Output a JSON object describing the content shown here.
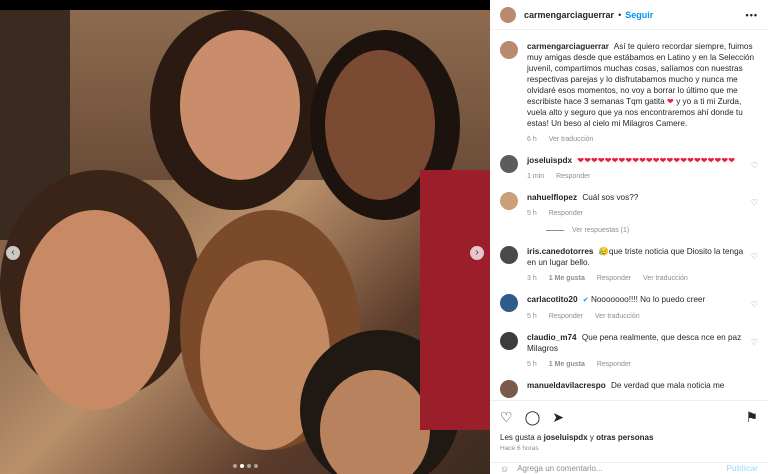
{
  "header": {
    "username": "carmengarciaguerrar",
    "separator": "•",
    "follow_label": "Seguir",
    "more_label": "•••"
  },
  "caption": {
    "username": "carmengarciaguerrar",
    "text_part1": "Así te quiero recordar siempre, fuimos muy amigas desde que estábamos en Latino y en la Selección juvenil, compartimos muchas cosas, salíamos con nuestras respectivas parejas y lo disfrutabamos mucho y nunca me olvidaré esos momentos, no voy a borrar lo último que me escribiste hace 3 semanas Tqm gatita",
    "heart": "❤",
    "text_part2": "y yo a ti mi Zurda, vuela alto y seguro que ya nos encontraremos ahí donde tu estas! Un beso al cielo mi Milagros Camere.",
    "time": "6 h",
    "translate": "Ver traducción"
  },
  "comments": [
    {
      "username": "joseluispdx",
      "text": "❤❤❤❤❤❤❤❤❤❤❤❤❤❤❤❤❤❤❤❤❤❤❤",
      "time": "1 min",
      "likes": "",
      "reply": "Responder",
      "translate": "",
      "avatar_color": "#5c5c5c",
      "is_hearts": true
    },
    {
      "username": "nahuelflopez",
      "text": "Cuál sos vos??",
      "time": "5 h",
      "likes": "",
      "reply": "Responder",
      "translate": "",
      "avatar_color": "#c9a07a",
      "is_hearts": false
    },
    {
      "username": "iris.canedotorres",
      "text": "😥que triste noticia que Diosito la tenga en un lugar bello.",
      "time": "3 h",
      "likes": "1 Me gusta",
      "reply": "Responder",
      "translate": "Ver traducción",
      "avatar_color": "#4a4a4a",
      "is_hearts": false
    },
    {
      "username": "carlacotito20",
      "text": "Nooooooo!!!! No lo puedo creer",
      "time": "5 h",
      "likes": "",
      "reply": "Responder",
      "translate": "Ver traducción",
      "avatar_color": "#2f5a8c",
      "is_hearts": false
    },
    {
      "username": "claudio_m74",
      "text": "Que pena realmente, que desca nce en paz Milagros",
      "time": "5 h",
      "likes": "1 Me gusta",
      "reply": "Responder",
      "translate": "",
      "avatar_color": "#3d3d3d",
      "is_hearts": false
    },
    {
      "username": "manueldavilacrespo",
      "text": "De verdad que mala noticia me",
      "time": "",
      "likes": "",
      "reply": "",
      "translate": "",
      "avatar_color": "#7a5a4a",
      "is_hearts": false
    }
  ],
  "view_replies": "Ver respuestas (1)",
  "actions": {
    "likes_prefix": "Les gusta a",
    "likes_user": "joseluispdx",
    "likes_and": "y",
    "likes_others": "otras personas",
    "posted": "Hace 6 horas"
  },
  "add_comment": {
    "placeholder": "Agrega un comentario...",
    "publish": "Publicar"
  },
  "colors": {
    "link": "#0095f6",
    "heart": "#ed1c3c",
    "muted": "#8e8e8e"
  }
}
